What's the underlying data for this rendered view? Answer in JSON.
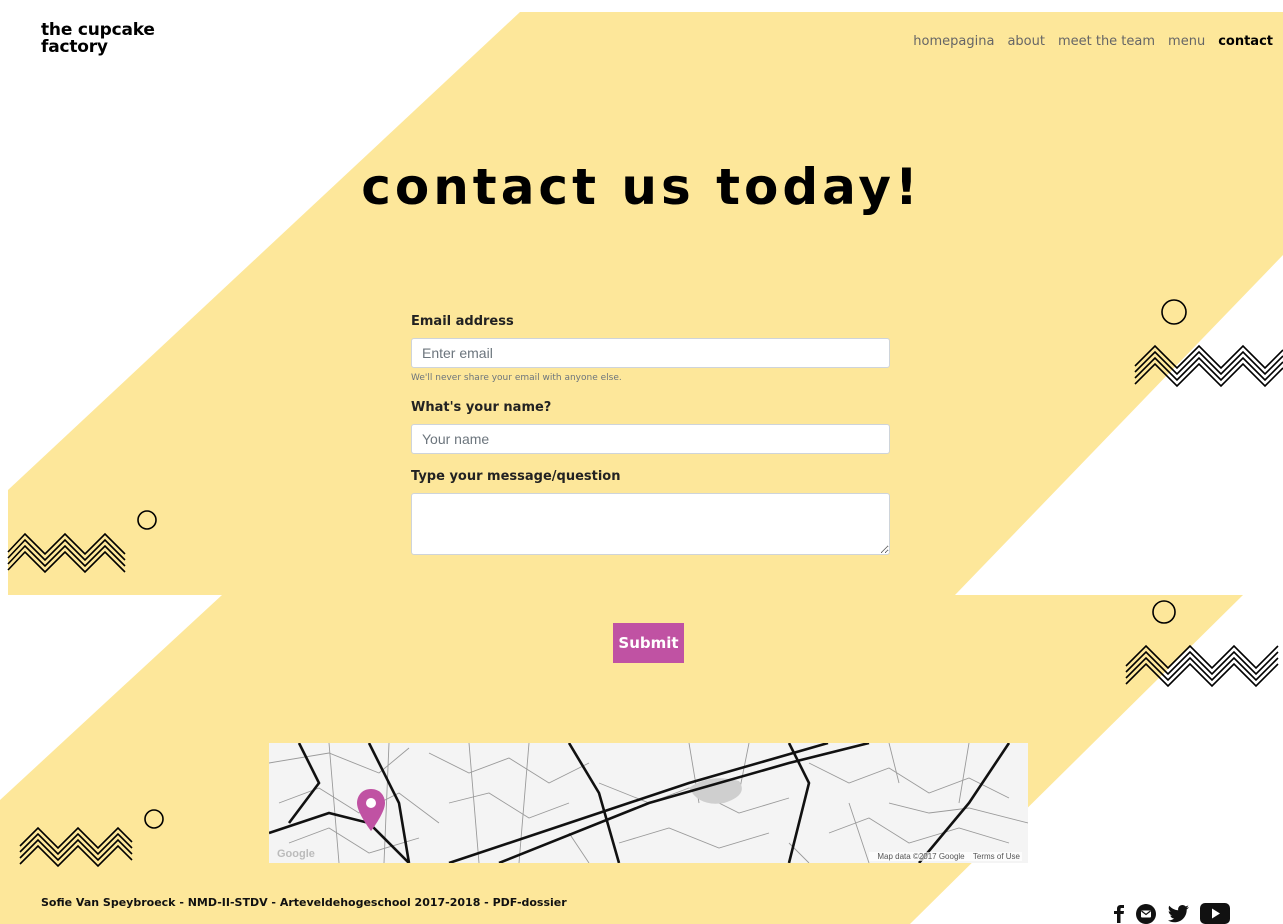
{
  "brand": {
    "line1": "the cupcake",
    "line2": "factory"
  },
  "nav": [
    {
      "label": "homepagina",
      "active": false
    },
    {
      "label": "about",
      "active": false
    },
    {
      "label": "meet the team",
      "active": false
    },
    {
      "label": "menu",
      "active": false
    },
    {
      "label": "contact",
      "active": true
    }
  ],
  "hero": {
    "title": "contact us today!"
  },
  "form": {
    "email": {
      "label": "Email address",
      "placeholder": "Enter email",
      "value": "",
      "help": "We'll never share your email with anyone else."
    },
    "name": {
      "label": "What's your name?",
      "placeholder": "Your name",
      "value": ""
    },
    "message": {
      "label": "Type your message/question",
      "value": ""
    },
    "submit_label": "Submit"
  },
  "map": {
    "watermark": "Google",
    "attribution": "Map data ©2017 Google",
    "terms": "Terms of Use",
    "marker_color": "#c052a3"
  },
  "footer": {
    "credit": "Sofie Van Speybroeck - NMD-II-STDV - Arteveldehogeschool 2017-2018 - PDF-dossier",
    "social": [
      "facebook-icon",
      "email-icon",
      "twitter-icon",
      "youtube-icon"
    ]
  },
  "colors": {
    "background": "#ffffff",
    "band": "#fde79a",
    "accent": "#c052a3",
    "text": "#111111"
  }
}
